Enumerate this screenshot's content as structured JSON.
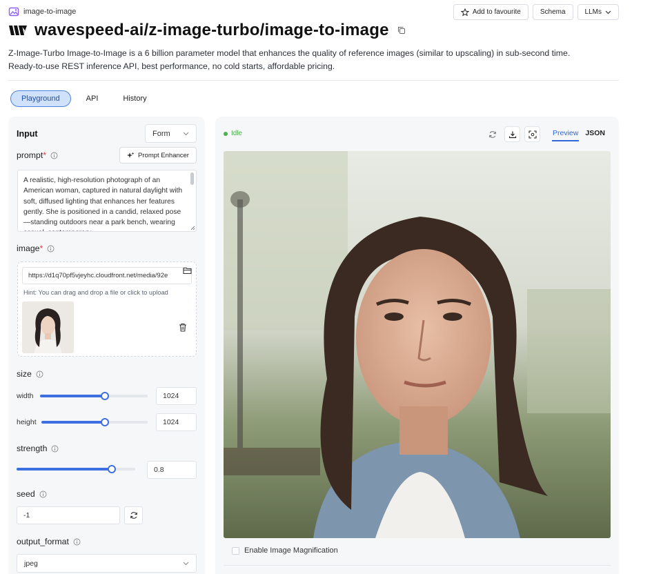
{
  "header": {
    "breadcrumb": "image-to-image",
    "title": "wavespeed-ai/z-image-turbo/image-to-image",
    "description_line1": "Z-Image-Turbo Image-to-Image is a 6 billion parameter model that enhances the quality of reference images (similar to upscaling) in sub-second time.",
    "description_line2": "Ready-to-use REST inference API, best performance, no cold starts, affordable pricing.",
    "actions": {
      "favourite": "Add to favourite",
      "schema": "Schema",
      "llms": "LLMs"
    }
  },
  "tabs": [
    "Playground",
    "API",
    "History"
  ],
  "input_panel": {
    "heading": "Input",
    "mode": "Form",
    "prompt": {
      "label": "prompt",
      "enhancer": "Prompt Enhancer",
      "value": "A realistic, high-resolution photograph of an American woman, captured in natural daylight with soft, diffused lighting that enhances her features gently. She is positioned in a candid, relaxed pose—standing outdoors near a park bench, wearing casual, contemporary"
    },
    "image": {
      "label": "image",
      "url": "https://d1q70pf5vjeyhc.cloudfront.net/media/92e",
      "hint": "Hint: You can drag and drop a file or click to upload"
    },
    "size": {
      "label": "size",
      "width_label": "width",
      "width_value": "1024",
      "width_fraction": 0.6,
      "height_label": "height",
      "height_value": "1024",
      "height_fraction": 0.6
    },
    "strength": {
      "label": "strength",
      "value": "0.8",
      "fraction": 0.8
    },
    "seed": {
      "label": "seed",
      "value": "-1"
    },
    "output_format": {
      "label": "output_format",
      "value": "jpeg"
    }
  },
  "output_panel": {
    "status": "Idle",
    "view_tabs": [
      "Preview",
      "JSON"
    ],
    "magnify_label": "Enable Image Magnification"
  },
  "colors": {
    "accent": "#3d6fe0",
    "status": "#4caf50",
    "required": "#e53935"
  }
}
